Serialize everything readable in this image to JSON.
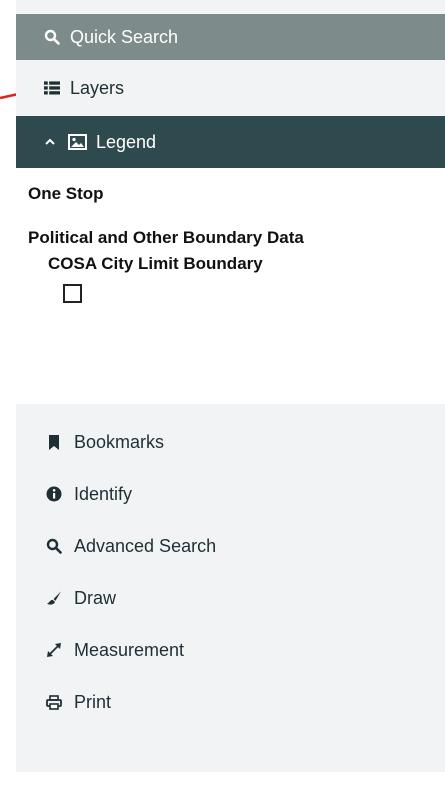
{
  "quick_search": {
    "label": "Quick Search",
    "icon": "search-icon"
  },
  "layers": {
    "label": "Layers",
    "icon": "list-icon"
  },
  "legend": {
    "label": "Legend",
    "chevron": "chevron-up-icon",
    "icon": "image-icon",
    "title": "One Stop",
    "group": "Political and Other Boundary Data",
    "layer": "COSA City Limit Boundary"
  },
  "tools": [
    {
      "label": "Bookmarks",
      "icon": "bookmark-icon"
    },
    {
      "label": "Identify",
      "icon": "info-icon"
    },
    {
      "label": "Advanced Search",
      "icon": "search-icon"
    },
    {
      "label": "Draw",
      "icon": "brush-icon"
    },
    {
      "label": "Measurement",
      "icon": "expand-arrows-icon"
    },
    {
      "label": "Print",
      "icon": "printer-icon"
    }
  ],
  "colors": {
    "quick_bg": "#7d8b8a",
    "legend_bg": "#2f4a4e",
    "panel_bg": "#f1f3f5",
    "annotation_arrow": "#e0201a"
  }
}
